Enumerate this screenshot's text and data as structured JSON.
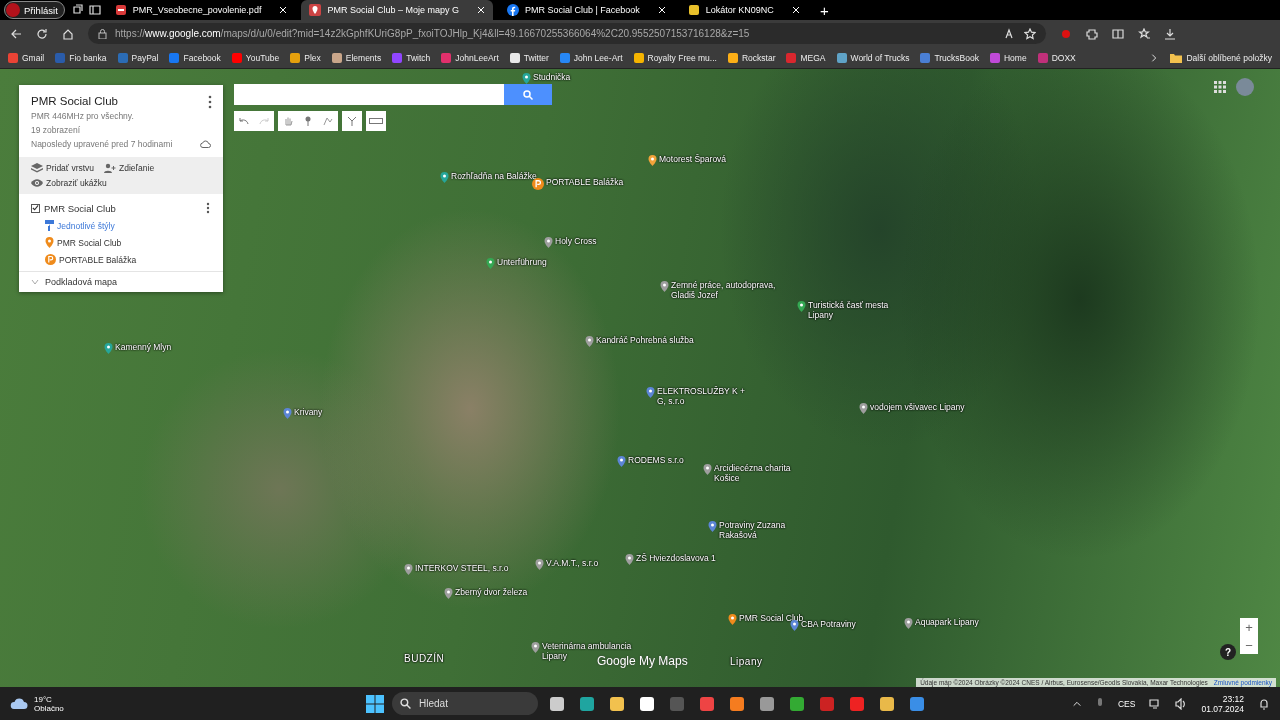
{
  "browser": {
    "profile": "Přihlásit",
    "tabs": [
      {
        "title": "PMR_Vseobecne_povolenie.pdf",
        "kind": "pdf",
        "selected": false
      },
      {
        "title": "PMR Social Club – Moje mapy G",
        "kind": "maps",
        "selected": true
      },
      {
        "title": "PMR Social Club | Facebook",
        "kind": "facebook",
        "selected": false
      },
      {
        "title": "Lokátor KN09NC",
        "kind": "generic",
        "selected": false
      }
    ],
    "new_tab": "+",
    "url": {
      "scheme": "https://",
      "host": "www.google.com",
      "path": "/maps/d/u/0/edit?mid=14z2kGphfKUriG8pP_fxoiTOJHlp_Kj4&ll=49.16670255366064%2C20.9552507153716128&z=15"
    },
    "bookmarks": [
      {
        "label": "Gmail",
        "color": "#ea4335"
      },
      {
        "label": "Fio banka",
        "color": "#2a5caa"
      },
      {
        "label": "PayPal",
        "color": "#2b6cb5"
      },
      {
        "label": "Facebook",
        "color": "#1877f2"
      },
      {
        "label": "YouTube",
        "color": "#ff0000"
      },
      {
        "label": "Plex",
        "color": "#e5a00d"
      },
      {
        "label": "Elements",
        "color": "#c9a68a"
      },
      {
        "label": "Twitch",
        "color": "#9146ff"
      },
      {
        "label": "JohnLeeArt",
        "color": "#e1306c"
      },
      {
        "label": "Twitter",
        "color": "#e8e8e8"
      },
      {
        "label": "John Lee-Art",
        "color": "#2787f5"
      },
      {
        "label": "Royalty Free mu...",
        "color": "#f5b400"
      },
      {
        "label": "Rockstar",
        "color": "#fcaf17"
      },
      {
        "label": "MEGA",
        "color": "#d9272e"
      },
      {
        "label": "World of Trucks",
        "color": "#5fa3c7"
      },
      {
        "label": "TrucksBook",
        "color": "#4a7fd4"
      },
      {
        "label": "Home",
        "color": "#c04ad8"
      },
      {
        "label": "DOXX",
        "color": "#c0307a"
      }
    ],
    "other_bookmarks": "Další oblíbené položky"
  },
  "panel": {
    "title": "PMR Social Club",
    "description": "PMR 446MHz pro všechny.",
    "views": "19 zobrazení",
    "last_edited": "Naposledy upravené pred 7 hodinami",
    "actions": [
      {
        "label": "Pridať vrstvu",
        "kind": "layers"
      },
      {
        "label": "Zdieľanie",
        "kind": "share"
      },
      {
        "label": "Zobraziť ukážku",
        "kind": "preview"
      }
    ],
    "layer": {
      "name": "PMR Social Club",
      "checked": true,
      "style": "Jednotlivé štýly",
      "items": [
        {
          "label": "PMR Social Club",
          "kind": "pin"
        },
        {
          "label": "PORTABLE Balážka",
          "kind": "parking"
        }
      ]
    },
    "base_map": "Podkladová mapa"
  },
  "map": {
    "places": [
      {
        "label": "Studnička",
        "kind": "pin",
        "color": "#26a69a"
      },
      {
        "label": "Motorest Šparová",
        "kind": "pin",
        "color": "#f2a33a"
      },
      {
        "label": "Rozhľadňa na Balážke",
        "kind": "pin",
        "color": "#26a69a"
      },
      {
        "label": "PORTABLE Balážka",
        "kind": "parking",
        "color": "#ef8b1c"
      },
      {
        "label": "Holy Cross",
        "kind": "pin",
        "color": "#9e9e9e"
      },
      {
        "label": "Unterführung",
        "kind": "pin",
        "color": "#34a853"
      },
      {
        "label": "Zemné práce, autodoprava, Gladiš Jozef",
        "kind": "pin",
        "color": "#9e9e9e"
      },
      {
        "label": "Turistická časť mesta Lipany",
        "kind": "pin",
        "color": "#34a853"
      },
      {
        "label": "Kandráč Pohrebná služba",
        "kind": "pin",
        "color": "#9e9e9e"
      },
      {
        "label": "ELEKTROSLUŽBY K + G, s.r.o",
        "kind": "pin",
        "color": "#5c85d6"
      },
      {
        "label": "vodojem všivavec Lipany",
        "kind": "pin",
        "color": "#9e9e9e"
      },
      {
        "label": "Kamenný Mlyn",
        "kind": "pin",
        "color": "#26a69a"
      },
      {
        "label": "Krivany",
        "kind": "pin",
        "color": "#5c85d6"
      },
      {
        "label": "RODEMS s.r.o",
        "kind": "pin",
        "color": "#5c85d6"
      },
      {
        "label": "Arcidiecézna charita Košice",
        "kind": "pin",
        "color": "#9e9e9e"
      },
      {
        "label": "Potraviny Zuzana Rakašová",
        "kind": "pin",
        "color": "#5c85d6"
      },
      {
        "label": "ZŠ Hviezdoslavova 1",
        "kind": "pin",
        "color": "#9e9e9e"
      },
      {
        "label": "INTERKOV STEEL, s.r.o",
        "kind": "pin",
        "color": "#9e9e9e"
      },
      {
        "label": "V.A.M.T., s.r.o",
        "kind": "pin",
        "color": "#9e9e9e"
      },
      {
        "label": "Zberný dvor železa",
        "kind": "pin",
        "color": "#9e9e9e"
      },
      {
        "label": "PMR Social Club",
        "kind": "pin",
        "color": "#ef8b1c"
      },
      {
        "label": "CBA Potraviny",
        "kind": "pin",
        "color": "#5c85d6"
      },
      {
        "label": "Aquapark Lipany",
        "kind": "pin",
        "color": "#9e9e9e"
      },
      {
        "label": "BUDZÍN",
        "kind": "town"
      },
      {
        "label": "Veterinárna ambulancia Lipany",
        "kind": "pin",
        "color": "#9e9e9e"
      },
      {
        "label": "Lipany",
        "kind": "town"
      }
    ],
    "logo": "Google My Maps",
    "attribution": "Údaje máp ©2024 Obrázky ©2024 CNES / Airbus, Eurosense/Geodis Slovakia, Maxar Technologies",
    "terms": "Zmluvné podmienky",
    "zoom_in": "+",
    "zoom_out": "−",
    "help": "?"
  },
  "taskbar": {
    "temperature": "19°C",
    "weather": "Oblačno",
    "search_placeholder": "Hledat",
    "language": "CES",
    "time": "23:12",
    "date": "01.07.2024"
  }
}
